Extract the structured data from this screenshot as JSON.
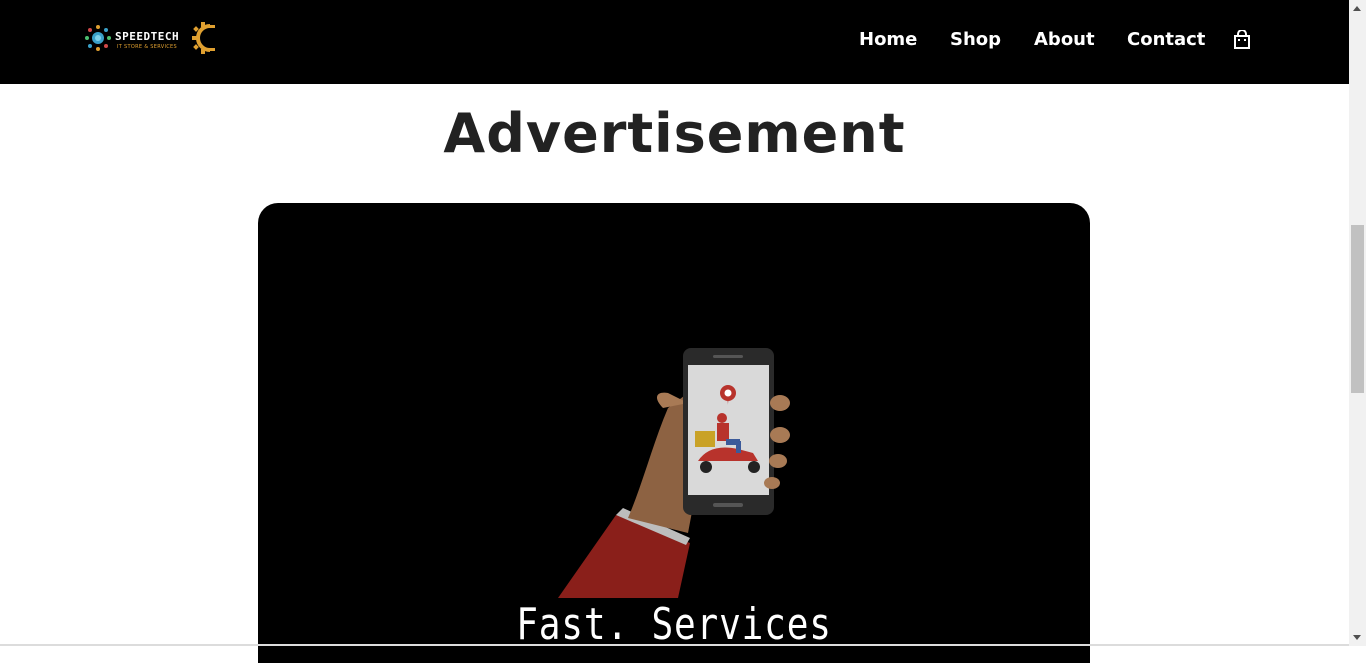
{
  "header": {
    "logo": {
      "brand": "SPEEDTECH",
      "tagline": "IT STORE & SERVICES",
      "icon": "gear-icon"
    },
    "nav": [
      {
        "label": "Home"
      },
      {
        "label": "Shop"
      },
      {
        "label": "About"
      },
      {
        "label": "Contact"
      }
    ],
    "cart_icon": "shopping-bag-icon"
  },
  "main": {
    "title": "Advertisement",
    "ad": {
      "caption": "Fast. Services",
      "illustration": "phone-delivery-scooter-icon"
    }
  },
  "colors": {
    "header_bg": "#000000",
    "accent": "#e0a030",
    "title_text": "#222222",
    "ad_bg": "#000000"
  }
}
